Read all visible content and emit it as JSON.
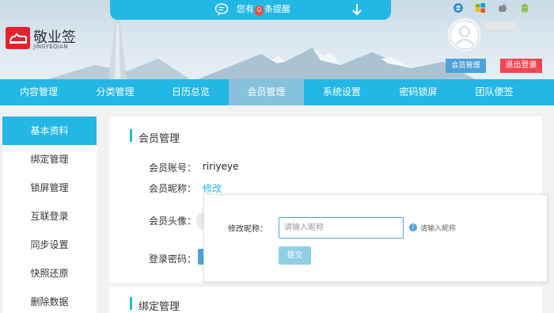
{
  "notification": {
    "prefix": "您有",
    "count": "0",
    "suffix": "条提醒"
  },
  "brand": {
    "name": "敬业签",
    "subtitle": "JINGYEQIAN"
  },
  "header": {
    "member_button": "会员管理",
    "logout_button": "退出登录"
  },
  "nav": {
    "items": [
      "内容管理",
      "分类管理",
      "日历总览",
      "会员管理",
      "系统设置",
      "密码锁屏",
      "团队便签"
    ],
    "active_index": 3
  },
  "sidebar": {
    "items": [
      "基本资料",
      "绑定管理",
      "锁屏管理",
      "互联登录",
      "同步设置",
      "快照还原",
      "删除数据"
    ],
    "active_index": 0
  },
  "main": {
    "section_title": "会员管理",
    "account_label": "会员账号：",
    "account_value": "ririyeye",
    "nickname_label": "会员昵称：",
    "nickname_edit": "修改",
    "avatar_label": "会员头像：",
    "password_label": "登录密码："
  },
  "section2": {
    "title": "绑定管理"
  },
  "popup": {
    "label": "修改昵称：",
    "input_placeholder": "请输入昵称",
    "hint": "请输入昵称",
    "submit": "提交"
  },
  "colors": {
    "accent": "#23b7e5",
    "nav_active": "#86c2de",
    "logout": "#f04653",
    "member_button": "#4ea2d7"
  }
}
